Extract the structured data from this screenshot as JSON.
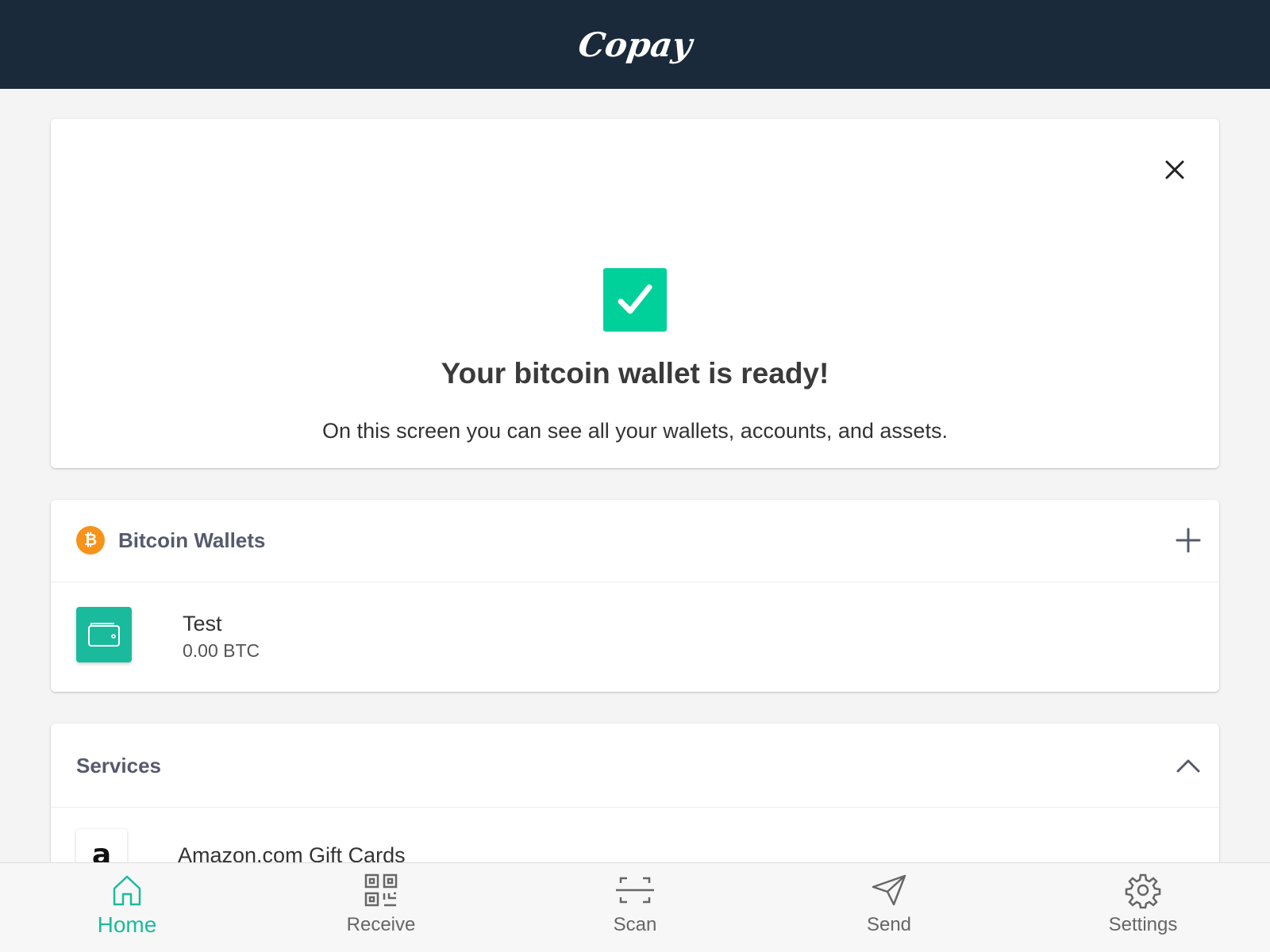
{
  "header": {
    "logo_text": "Copay"
  },
  "ready_card": {
    "title": "Your bitcoin wallet is ready!",
    "subtitle": "On this screen you can see all your wallets, accounts, and assets.",
    "check_color": "#00d19a"
  },
  "wallets": {
    "title": "Bitcoin Wallets",
    "coin_symbol": "₿",
    "items": [
      {
        "name": "Test",
        "balance": "0.00 BTC",
        "icon_color": "#1abb9c"
      }
    ]
  },
  "services": {
    "title": "Services",
    "items": [
      {
        "label": "Amazon.com Gift Cards",
        "logo_letter": "a"
      }
    ]
  },
  "nav": {
    "items": [
      {
        "label": "Home",
        "icon": "home-icon",
        "active": true
      },
      {
        "label": "Receive",
        "icon": "qr-code-icon",
        "active": false
      },
      {
        "label": "Scan",
        "icon": "scan-icon",
        "active": false
      },
      {
        "label": "Send",
        "icon": "paper-plane-icon",
        "active": false
      },
      {
        "label": "Settings",
        "icon": "gear-icon",
        "active": false
      }
    ]
  },
  "colors": {
    "header_bg": "#1b2a3a",
    "accent": "#1abb9c",
    "bitcoin_orange": "#f7931a"
  }
}
